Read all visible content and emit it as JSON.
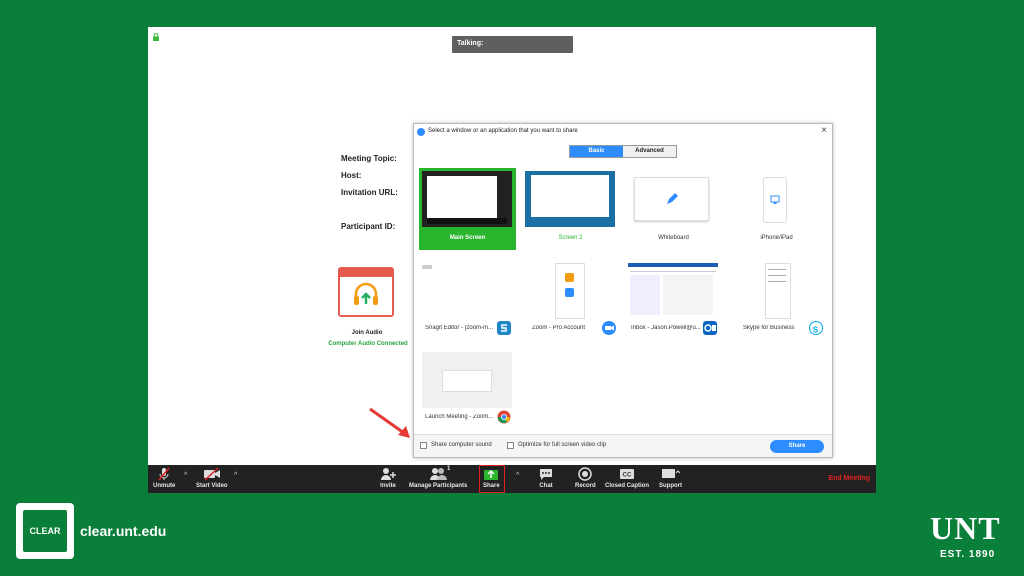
{
  "meeting": {
    "talking_label": "Talking:",
    "info_labels": [
      "Meeting Topic:",
      "Host:",
      "Invitation URL:",
      "Participant ID:"
    ],
    "join_audio_label": "Join Audio",
    "audio_status": "Computer Audio Connected"
  },
  "dialog": {
    "title": "Select a window or an application that you want to share",
    "close_glyph": "×",
    "tabs": [
      "Basic",
      "Advanced"
    ],
    "tiles": [
      {
        "label": "Main Screen"
      },
      {
        "label": "Screen 2"
      },
      {
        "label": "Whiteboard"
      },
      {
        "label": "iPhone/iPad"
      },
      {
        "label": "Snagit Editor - [zoom-m..."
      },
      {
        "label": "Zoom - Pro Account"
      },
      {
        "label": "Inbox - Jason.Powell@u..."
      },
      {
        "label": "Skype for Business"
      },
      {
        "label": "Launch Meeting - Zoom..."
      }
    ],
    "share_sound_label": "Share computer sound",
    "optimize_label": "Optimize for full screen video clip",
    "share_button": "Share"
  },
  "toolbar": {
    "unmute": "Unmute",
    "start_video": "Start Video",
    "invite": "Invite",
    "manage_participants": "Manage Participants",
    "participant_count": "1",
    "share": "Share",
    "chat": "Chat",
    "record": "Record",
    "closed_caption": "Closed Caption",
    "support": "Support",
    "end_meeting": "End Meeting",
    "cc_glyph": "CC"
  },
  "branding": {
    "clear_logo": "CLEAR",
    "url": "clear.unt.edu",
    "unt": "UNT",
    "est": "EST. 1890"
  },
  "colors": {
    "background": "#0a7f3a",
    "accent_blue": "#2d8cff",
    "selected_green": "#2ab52e",
    "end_meeting_red": "#e02020"
  }
}
